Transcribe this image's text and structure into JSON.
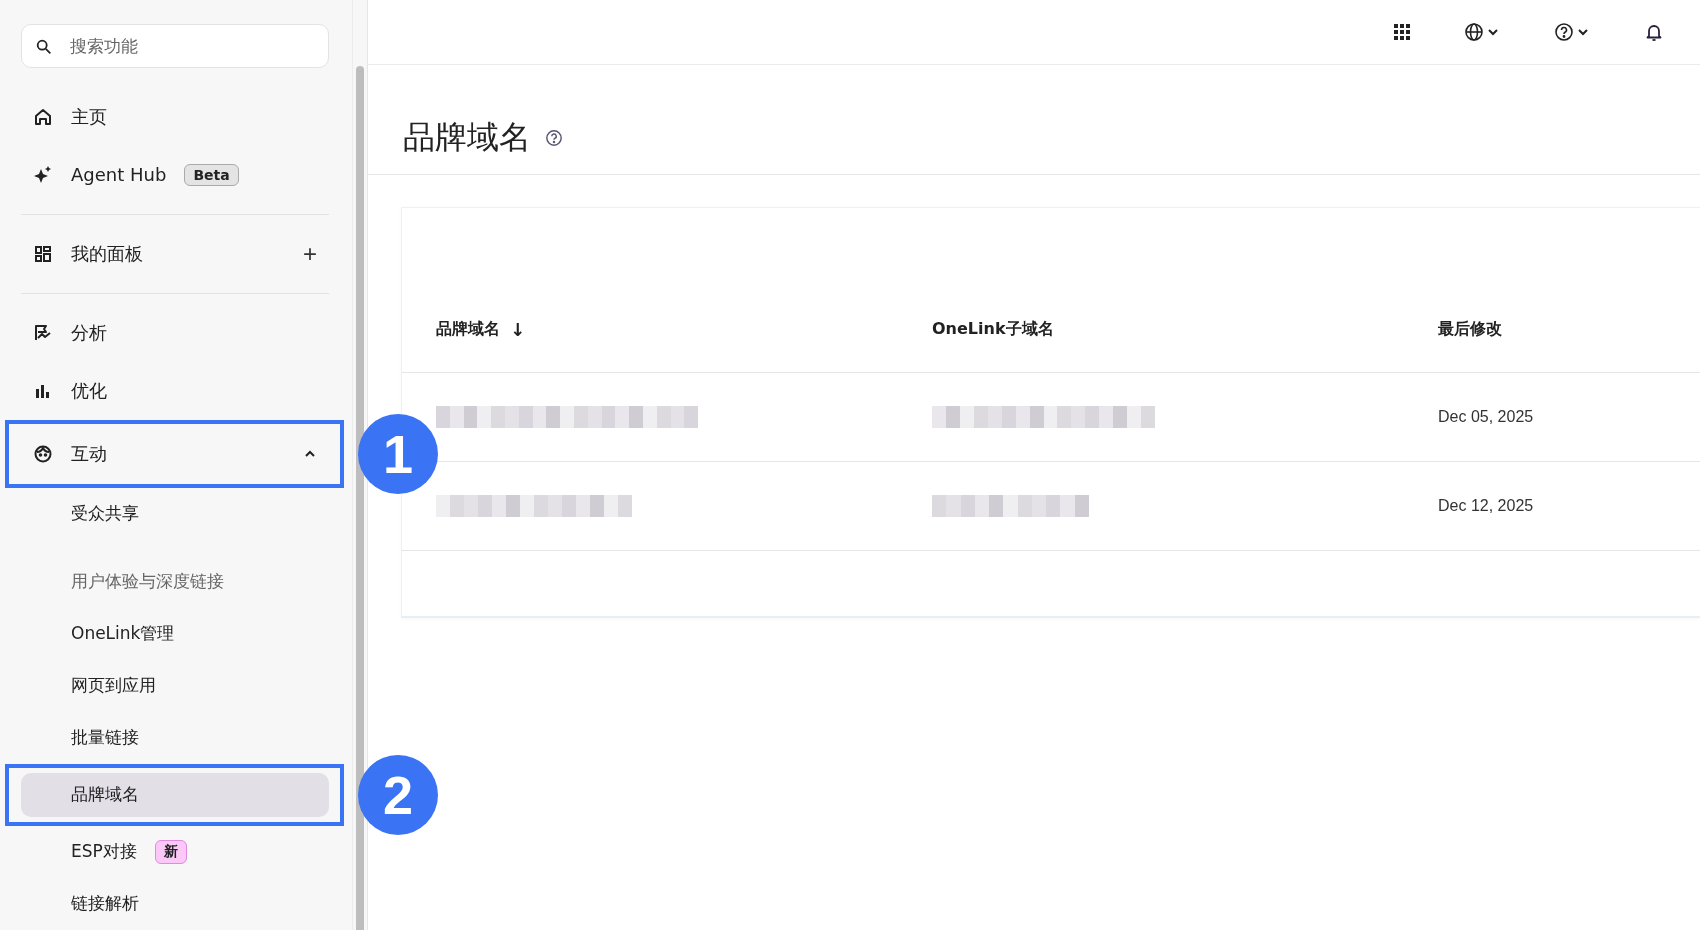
{
  "sidebar": {
    "search": {
      "placeholder": "搜索功能"
    },
    "sections": [
      {
        "items": [
          {
            "kind": "home",
            "label": "主页",
            "selected": false
          },
          {
            "kind": "sparkle",
            "label": "Agent Hub",
            "badge": {
              "text": "Beta",
              "kind": "beta"
            },
            "selected": false
          }
        ]
      },
      {
        "items": [
          {
            "kind": "dashboard",
            "label": "我的面板",
            "add_button": "+",
            "selected": false
          }
        ]
      },
      {
        "items": [
          {
            "kind": "chart-line",
            "label": "分析",
            "selected": false
          },
          {
            "kind": "bars",
            "label": "优化",
            "selected": false
          },
          {
            "kind": "face",
            "label": "互动",
            "expanded": true,
            "callout": "1",
            "selected": false,
            "children": [
              {
                "kind": "link",
                "label": "受众共享",
                "selected": false
              },
              {
                "kind": "heading",
                "label": "用户体验与深度链接"
              },
              {
                "kind": "link",
                "label": "OneLink管理",
                "selected": false
              },
              {
                "kind": "link",
                "label": "网页到应用",
                "selected": false
              },
              {
                "kind": "link",
                "label": "批量链接",
                "selected": false
              },
              {
                "kind": "link",
                "label": "品牌域名",
                "selected": true,
                "callout": "2"
              },
              {
                "kind": "link",
                "label": "ESP对接",
                "badge": {
                  "text": "新",
                  "kind": "new"
                },
                "selected": false
              },
              {
                "kind": "link",
                "label": "链接解析",
                "selected": false
              }
            ]
          }
        ]
      }
    ]
  },
  "page": {
    "title": "品牌域名"
  },
  "table": {
    "columns": [
      {
        "label": "品牌域名",
        "sort_arrow": "↓"
      },
      {
        "label": "OneLink子域名"
      },
      {
        "label": "最后修改"
      }
    ],
    "rows": [
      {
        "cells": [
          {
            "kind": "redacted"
          },
          {
            "kind": "redacted"
          },
          {
            "kind": "text",
            "text": "Dec 05, 2025"
          }
        ]
      },
      {
        "cells": [
          {
            "kind": "redacted"
          },
          {
            "kind": "redacted"
          },
          {
            "kind": "text",
            "text": "Dec 12, 2025"
          }
        ]
      }
    ]
  }
}
